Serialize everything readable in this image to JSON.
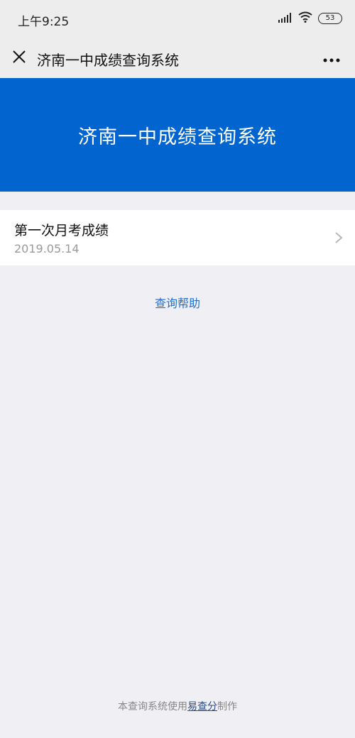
{
  "status_bar": {
    "time": "上午9:25",
    "battery": "53",
    "signal_icon": "signal-icon",
    "wifi_icon": "wifi-icon",
    "battery_icon": "battery-icon"
  },
  "nav": {
    "title": "济南一中成绩查询系统",
    "close_icon": "close-icon",
    "more_icon": "more-icon"
  },
  "banner": {
    "title": "济南一中成绩查询系统",
    "color": "#0264CE"
  },
  "exams": [
    {
      "title": "第一次月考成绩",
      "date": "2019.05.14"
    }
  ],
  "help": {
    "label": "查询帮助"
  },
  "footer": {
    "prefix": "本查询系统使用",
    "link": "易查分",
    "suffix": "制作"
  }
}
